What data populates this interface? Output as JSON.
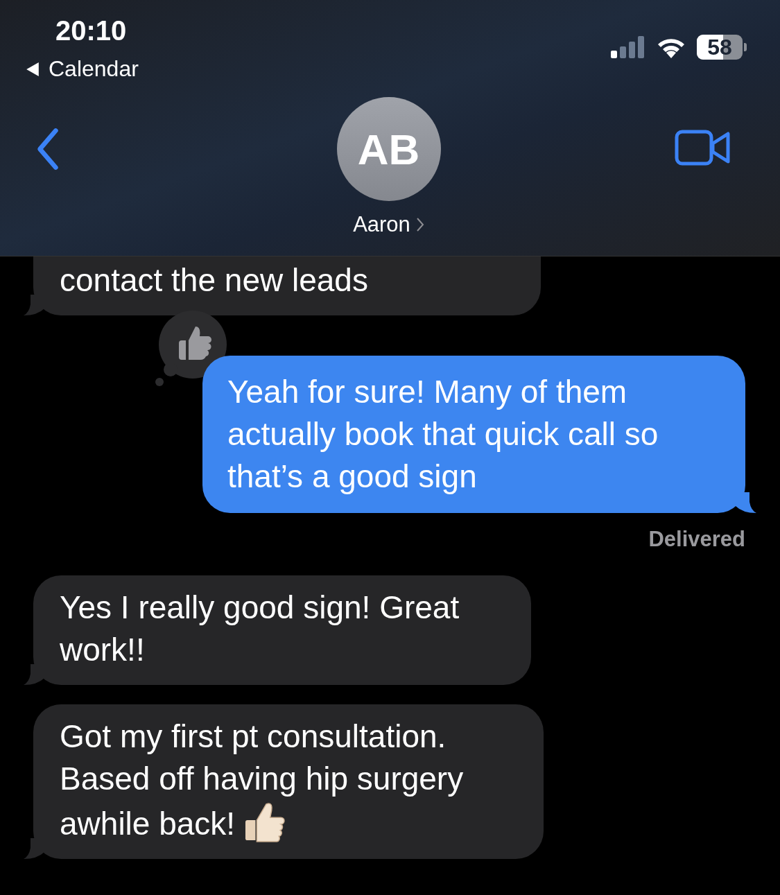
{
  "status_bar": {
    "time": "20:10",
    "back_app": "Calendar",
    "battery": "58"
  },
  "header": {
    "initials": "AB",
    "name": "Aaron"
  },
  "messages": [
    {
      "kind": "received",
      "text": "contact the new leads",
      "cut_top": true,
      "liked": false,
      "thumbs_emoji": false
    },
    {
      "kind": "sent",
      "text": "Yeah for sure! Many of them actually book that quick call so that’s a good sign",
      "cut_top": false,
      "liked": true,
      "thumbs_emoji": false,
      "status": "Delivered"
    },
    {
      "kind": "received",
      "text": "Yes I really good sign! Great work!!",
      "cut_top": false,
      "liked": false,
      "thumbs_emoji": false
    },
    {
      "kind": "received",
      "text": "Got my first pt consultation. Based off having hip surgery awhile back!",
      "cut_top": false,
      "liked": false,
      "thumbs_emoji": true
    }
  ]
}
